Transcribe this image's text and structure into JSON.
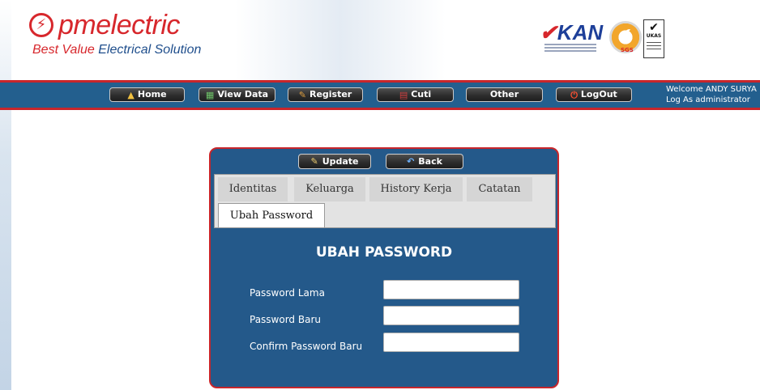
{
  "brand": {
    "bolt_glyph": "⚡",
    "name": "pmelectric",
    "tagline_part1": "Best Value ",
    "tagline_part2": "Electrical Solution",
    "red": "#d7272c",
    "blue": "#1f4e8c"
  },
  "certifications": {
    "kan_text": "KAN",
    "sgs_label": "SGS",
    "ukas_label": "UKAS"
  },
  "navbar": {
    "bg": "#235f8e",
    "accent": "#c8262b",
    "items": [
      {
        "label": "Home",
        "icon": "home-icon",
        "glyph": "▲"
      },
      {
        "label": "View Data",
        "icon": "view-data-icon",
        "glyph": "▦"
      },
      {
        "label": "Register",
        "icon": "register-icon",
        "glyph": "✎"
      },
      {
        "label": "Cuti",
        "icon": "calendar-icon",
        "glyph": "▤"
      },
      {
        "label": "Other",
        "icon": "",
        "glyph": ""
      },
      {
        "label": "LogOut",
        "icon": "power-icon",
        "glyph": "⏻"
      }
    ],
    "welcome_line1": "Welcome ANDY SURYA",
    "welcome_line2": "Log As administrator"
  },
  "panel": {
    "update_label": "Update",
    "back_label": "Back",
    "update_glyph": "✎",
    "back_glyph": "↶",
    "tabs": [
      {
        "label": "Identitas"
      },
      {
        "label": "Keluarga"
      },
      {
        "label": "History Kerja"
      },
      {
        "label": "Catatan"
      },
      {
        "label": "Ubah Password",
        "active": true
      }
    ],
    "form_title": "UBAH PASSWORD",
    "fields": [
      {
        "label": "Password Lama",
        "value": ""
      },
      {
        "label": "Password Baru",
        "value": ""
      },
      {
        "label": "Confirm Password Baru",
        "value": ""
      }
    ]
  }
}
